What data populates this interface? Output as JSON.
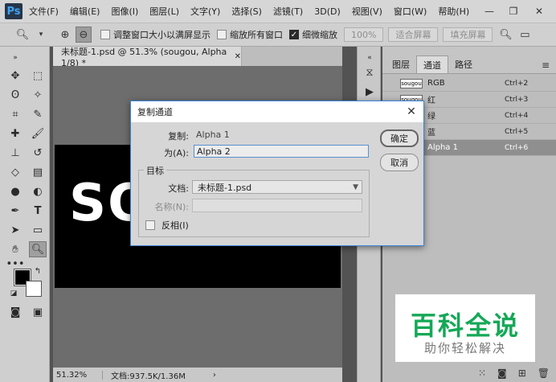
{
  "app": {
    "logo": "Ps"
  },
  "menu": [
    "文件(F)",
    "编辑(E)",
    "图像(I)",
    "图层(L)",
    "文字(Y)",
    "选择(S)",
    "滤镜(T)",
    "3D(D)",
    "视图(V)",
    "窗口(W)",
    "帮助(H)"
  ],
  "window_controls": {
    "minimize": "—",
    "restore": "❐",
    "close": "✕"
  },
  "options": {
    "resize_windows_label": "调整窗口大小以满屏显示",
    "zoom_all_label": "缩放所有窗口",
    "scrubby_zoom_label": "细微缩放",
    "zoom_100_button": "100%",
    "fit_screen_button": "适合屏幕",
    "fill_screen_button": "填充屏幕"
  },
  "document": {
    "tab_title": "未标题-1.psd @ 51.3% (sougou, Alpha 1/8) *",
    "tab_close": "✕",
    "canvas_text": "SO",
    "zoom": "51.32%",
    "doc_size": "文档:937.5K/1.36M"
  },
  "panel": {
    "tabs": [
      "图层",
      "通道",
      "路径"
    ],
    "channels": [
      {
        "thumb": "sougou",
        "name": "RGB",
        "shortcut": "Ctrl+2"
      },
      {
        "thumb": "sougou",
        "name": "红",
        "shortcut": "Ctrl+3"
      },
      {
        "thumb": "",
        "name": "绿",
        "shortcut": "Ctrl+4"
      },
      {
        "thumb": "",
        "name": "蓝",
        "shortcut": "Ctrl+5"
      },
      {
        "thumb": "",
        "name": "Alpha 1",
        "shortcut": "Ctrl+6"
      }
    ]
  },
  "dialog": {
    "title": "复制通道",
    "source_label": "复制:",
    "source_value": "Alpha 1",
    "as_label": "为(A):",
    "as_value": "Alpha 2",
    "ok_button": "确定",
    "cancel_button": "取消",
    "destination_group": "目标",
    "document_label": "文档:",
    "document_value": "未标题-1.psd",
    "name_label": "名称(N):",
    "name_value": "",
    "invert_label": "反相(I)"
  },
  "watermark": {
    "line1": "百科全说",
    "line2": "助你轻松解决"
  },
  "colors": {
    "accent": "#3b86d6",
    "watermark_green": "#15a857"
  }
}
